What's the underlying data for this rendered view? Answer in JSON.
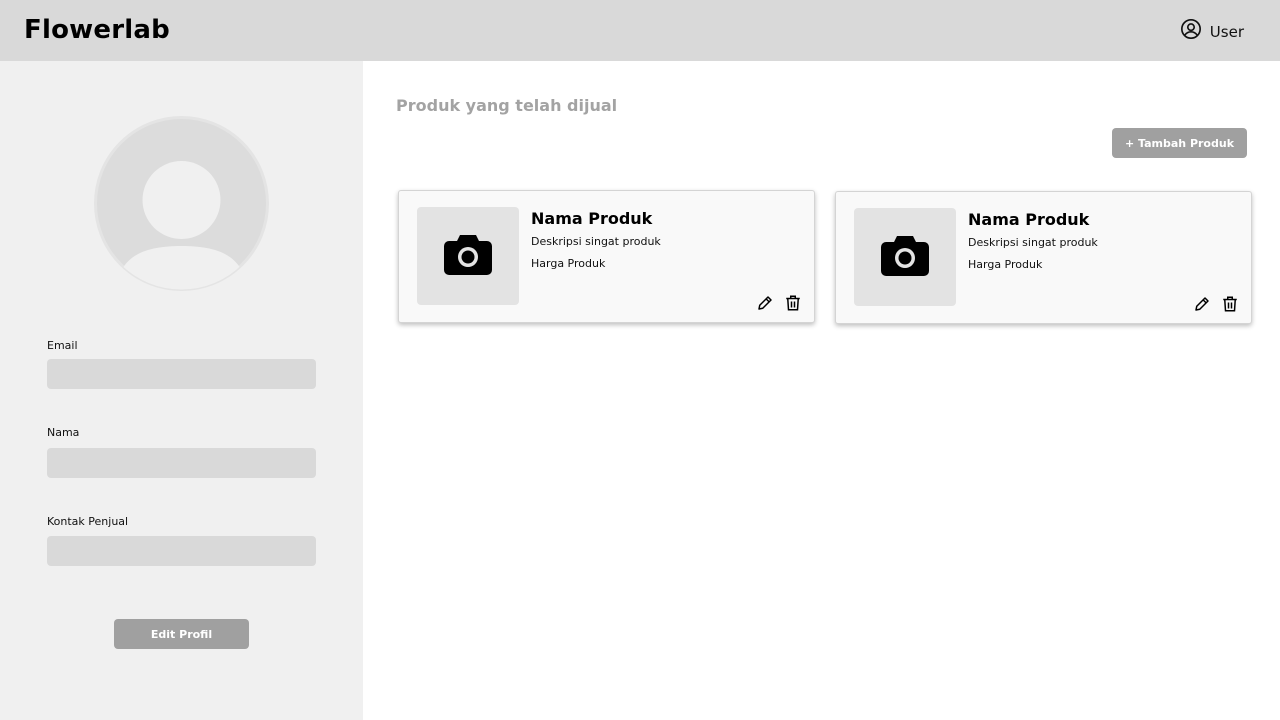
{
  "header": {
    "app_name": "Flowerlab",
    "user_label": "User",
    "user_icon": "user-circle-icon"
  },
  "profile": {
    "avatar_icon": "avatar-placeholder-icon",
    "fields": [
      {
        "label": "Email",
        "value": "",
        "placeholder": ""
      },
      {
        "label": "Nama",
        "value": "",
        "placeholder": ""
      },
      {
        "label": "Kontak Penjual",
        "value": "",
        "placeholder": ""
      }
    ],
    "edit_button_label": "Edit Profil"
  },
  "products_section": {
    "title": "Produk yang telah dijual",
    "add_button_label": "+ Tambah Produk",
    "products": [
      {
        "name": "Nama Produk",
        "description": "Deskripsi singat produk",
        "price": "Harga Produk",
        "image_icon": "camera-icon"
      },
      {
        "name": "Nama Produk",
        "description": "Deskripsi singat produk",
        "price": "Harga Produk",
        "image_icon": "camera-icon"
      }
    ]
  },
  "colors": {
    "header_bg": "#d9d9d9",
    "sidebar_bg": "#f0f0f0",
    "button_bg": "#a0a0a0",
    "input_bg": "#d9d9d9",
    "section_title": "#a3a3a3"
  }
}
